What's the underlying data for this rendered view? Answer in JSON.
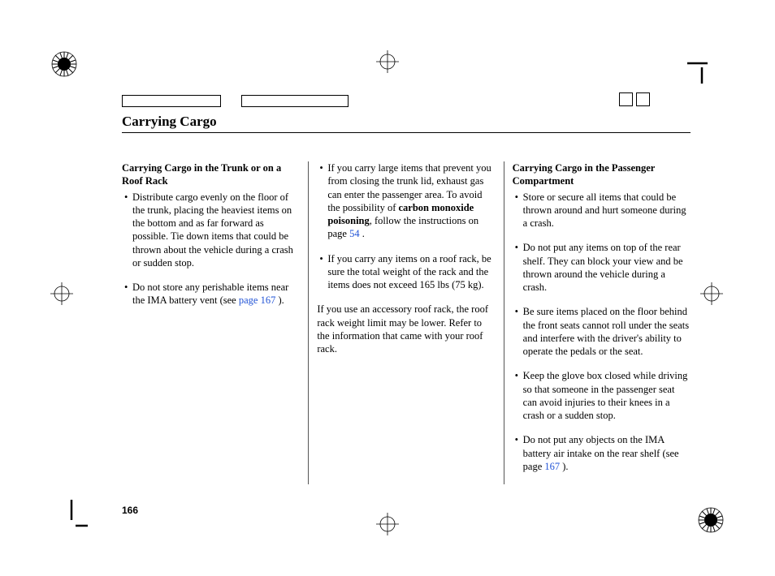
{
  "title": "Carrying Cargo",
  "page_number": "166",
  "left": {
    "heading": "Carrying Cargo in the Trunk or on a Roof Rack",
    "items": [
      "Distribute cargo evenly on the floor of the trunk, placing the heaviest items on the bottom and as far forward as possible. Tie down items that could be thrown about the vehicle during a crash or sudden stop.",
      {
        "pre": "Do not store any perishable items near the IMA battery vent (see ",
        "link": "page 167",
        "post": " )."
      }
    ]
  },
  "middle": {
    "item1": {
      "pre": "If you carry large items that prevent you from closing the trunk lid, exhaust gas can enter the passenger area. To avoid the possibility of ",
      "bold": "carbon monoxide poisoning",
      "mid": ", follow the instructions on page  ",
      "link": "54",
      "post": "  ."
    },
    "item2": "If you carry any items on a roof rack, be sure the total weight of the rack and the items does not exceed 165 lbs (75 kg).",
    "para": "If you use an accessory roof rack, the roof rack weight limit may be lower. Refer to the information that came with your roof rack."
  },
  "right": {
    "heading": "Carrying Cargo in the Passenger Compartment",
    "items": [
      "Store or secure all items that could be thrown around and hurt someone during a crash.",
      "Do not put any items on top of the rear shelf. They can block your view and be thrown around the vehicle during a crash.",
      "Be sure items placed on the floor behind the front seats cannot roll under the seats and interfere with the driver's ability to operate the pedals or the seat.",
      "Keep the glove box closed while driving so that someone in the passenger seat can avoid injuries to their knees in a crash or a sudden stop.",
      {
        "pre": "Do not put any objects on the IMA battery air intake on the rear shelf (see page ",
        "link": "167",
        "post": " )."
      }
    ]
  }
}
